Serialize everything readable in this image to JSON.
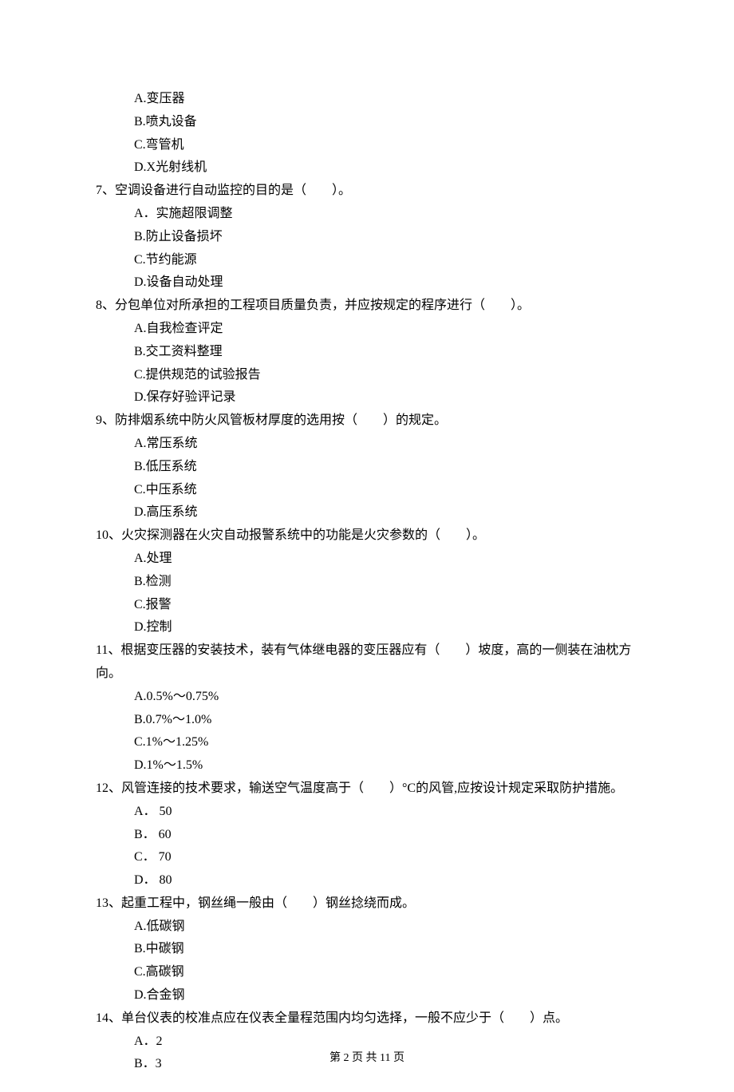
{
  "options_q6": {
    "A": "A.变压器",
    "B": "B.喷丸设备",
    "C": "C.弯管机",
    "D": "D.X光射线机"
  },
  "q7": {
    "text": "7、空调设备进行自动监控的目的是（　　）。",
    "A": "A．实施超限调整",
    "B": "B.防止设备损坏",
    "C": "C.节约能源",
    "D": "D.设备自动处理"
  },
  "q8": {
    "text": "8、分包单位对所承担的工程项目质量负责，并应按规定的程序进行（　　）。",
    "A": "A.自我检查评定",
    "B": "B.交工资料整理",
    "C": "C.提供规范的试验报告",
    "D": "D.保存好验评记录"
  },
  "q9": {
    "text": "9、防排烟系统中防火风管板材厚度的选用按（　　）的规定。",
    "A": "A.常压系统",
    "B": "B.低压系统",
    "C": "C.中压系统",
    "D": "D.高压系统"
  },
  "q10": {
    "text": "10、火灾探测器在火灾自动报警系统中的功能是火灾参数的（　　）。",
    "A": "A.处理",
    "B": "B.检测",
    "C": "C.报警",
    "D": "D.控制"
  },
  "q11": {
    "text": "11、根据变压器的安装技术，装有气体继电器的变压器应有（　　）坡度，高的一侧装在油枕方向。",
    "A": "A.0.5%～0.75%",
    "B": "B.0.7%～1.0%",
    "C": "C.1%～1.25%",
    "D": "D.1%～1.5%"
  },
  "q12": {
    "text": "12、风管连接的技术要求，输送空气温度高于（　　）°C的风管,应按设计规定采取防护措施。",
    "A": "A． 50",
    "B": "B． 60",
    "C": "C． 70",
    "D": "D． 80"
  },
  "q13": {
    "text": "13、起重工程中，钢丝绳一般由（　　）钢丝捻绕而成。",
    "A": "A.低碳钢",
    "B": "B.中碳钢",
    "C": "C.高碳钢",
    "D": "D.合金钢"
  },
  "q14": {
    "text": "14、单台仪表的校准点应在仪表全量程范围内均匀选择，一般不应少于（　　）点。",
    "A": "A．2",
    "B": "B．3"
  },
  "footer": "第 2 页 共 11 页"
}
